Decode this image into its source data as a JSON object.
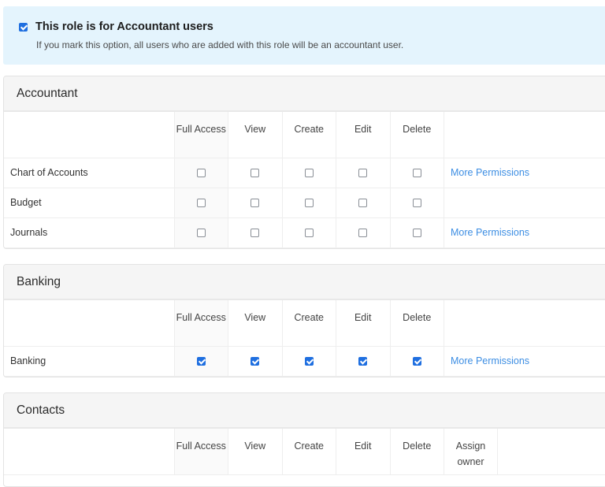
{
  "accountant_option": {
    "checked": true,
    "title": "This role is for Accountant users",
    "description": "If you mark this option, all users who are added with this role will be an accountant user."
  },
  "colors": {
    "alert_bg": "#e4f4fd",
    "checkbox_checked": "#1f6fe0",
    "link": "#3d8ee3"
  },
  "panels": {
    "accountant": {
      "title": "Accountant",
      "headers": {
        "full_access": "Full Access",
        "view": "View",
        "create": "Create",
        "edit": "Edit",
        "delete": "Delete"
      },
      "rows": [
        {
          "label": "Chart of Accounts",
          "full_access": false,
          "view": false,
          "create": false,
          "edit": false,
          "delete": false,
          "more": "More Permissions"
        },
        {
          "label": "Budget",
          "full_access": false,
          "view": false,
          "create": false,
          "edit": false,
          "delete": false,
          "more": ""
        },
        {
          "label": "Journals",
          "full_access": false,
          "view": false,
          "create": false,
          "edit": false,
          "delete": false,
          "more": "More Permissions"
        }
      ]
    },
    "banking": {
      "title": "Banking",
      "headers": {
        "full_access": "Full Access",
        "view": "View",
        "create": "Create",
        "edit": "Edit",
        "delete": "Delete"
      },
      "rows": [
        {
          "label": "Banking",
          "full_access": true,
          "view": true,
          "create": true,
          "edit": true,
          "delete": true,
          "more": "More Permissions"
        }
      ]
    },
    "contacts": {
      "title": "Contacts",
      "headers": {
        "full_access": "Full Access",
        "view": "View",
        "create": "Create",
        "edit": "Edit",
        "delete": "Delete",
        "assign_owner": "Assign owner"
      }
    }
  }
}
